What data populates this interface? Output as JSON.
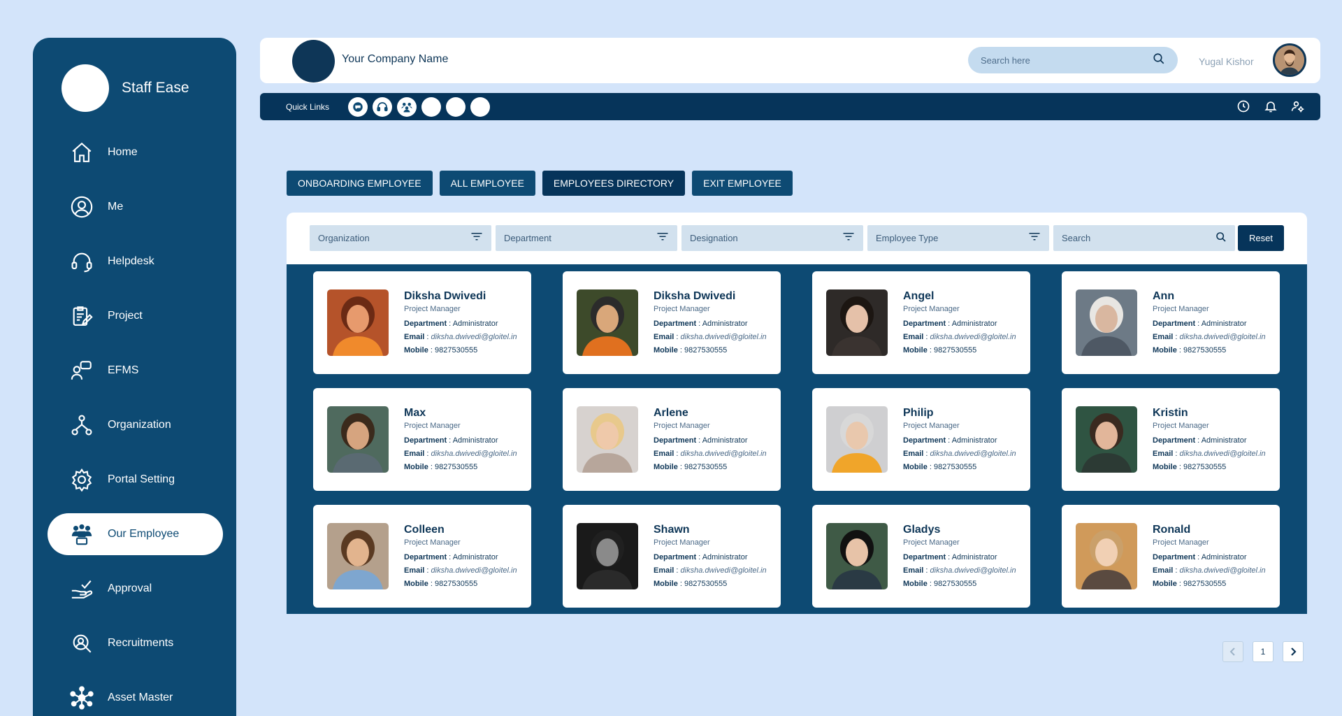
{
  "sidebar": {
    "brand": "Staff Ease",
    "items": [
      {
        "label": "Home",
        "icon": "home-icon"
      },
      {
        "label": "Me",
        "icon": "user-circle-icon"
      },
      {
        "label": "Helpdesk",
        "icon": "headset-icon"
      },
      {
        "label": "Project",
        "icon": "clipboard-edit-icon"
      },
      {
        "label": "EFMS",
        "icon": "chat-user-icon"
      },
      {
        "label": "Organization",
        "icon": "org-tree-icon"
      },
      {
        "label": "Portal Setting",
        "icon": "gear-icon"
      },
      {
        "label": "Our Employee",
        "icon": "team-icon",
        "active": true
      },
      {
        "label": "Approval",
        "icon": "hand-check-icon"
      },
      {
        "label": "Recruitments",
        "icon": "recruit-icon"
      },
      {
        "label": "Asset Master",
        "icon": "network-icon"
      }
    ]
  },
  "header": {
    "company_name": "Your Company Name",
    "search_placeholder": "Search here",
    "user_name": "Yugal Kishor"
  },
  "quickbar": {
    "label": "Quick Links"
  },
  "tabs": [
    {
      "label": "ONBOARDING EMPLOYEE"
    },
    {
      "label": "ALL EMPLOYEE"
    },
    {
      "label": "EMPLOYEES DIRECTORY",
      "active": true
    },
    {
      "label": "EXIT EMPLOYEE"
    }
  ],
  "filters": {
    "organization": "Organization",
    "department": "Department",
    "designation": "Designation",
    "employee_type": "Employee Type",
    "search_placeholder": "Search",
    "reset": "Reset"
  },
  "card_labels": {
    "department": "Department",
    "email": "Email",
    "mobile": "Mobile"
  },
  "employees": [
    {
      "name": "Diksha Dwivedi",
      "role": "Project Manager",
      "department": "Administrator",
      "email": "diksha.dwivedi@gloitel.in",
      "mobile": "9827530555"
    },
    {
      "name": "Diksha Dwivedi",
      "role": "Project Manager",
      "department": "Administrator",
      "email": "diksha.dwivedi@gloitel.in",
      "mobile": "9827530555"
    },
    {
      "name": "Angel",
      "role": "Project Manager",
      "department": "Administrator",
      "email": "diksha.dwivedi@gloitel.in",
      "mobile": "9827530555"
    },
    {
      "name": "Ann",
      "role": "Project Manager",
      "department": "Administrator",
      "email": "diksha.dwivedi@gloitel.in",
      "mobile": "9827530555"
    },
    {
      "name": "Max",
      "role": "Project Manager",
      "department": "Administrator",
      "email": "diksha.dwivedi@gloitel.in",
      "mobile": "9827530555"
    },
    {
      "name": "Arlene",
      "role": "Project Manager",
      "department": "Administrator",
      "email": "diksha.dwivedi@gloitel.in",
      "mobile": "9827530555"
    },
    {
      "name": "Philip",
      "role": "Project Manager",
      "department": "Administrator",
      "email": "diksha.dwivedi@gloitel.in",
      "mobile": "9827530555"
    },
    {
      "name": "Kristin",
      "role": "Project Manager",
      "department": "Administrator",
      "email": "diksha.dwivedi@gloitel.in",
      "mobile": "9827530555"
    },
    {
      "name": "Colleen",
      "role": "Project Manager",
      "department": "Administrator",
      "email": "diksha.dwivedi@gloitel.in",
      "mobile": "9827530555"
    },
    {
      "name": "Shawn",
      "role": "Project Manager",
      "department": "Administrator",
      "email": "diksha.dwivedi@gloitel.in",
      "mobile": "9827530555"
    },
    {
      "name": "Gladys",
      "role": "Project Manager",
      "department": "Administrator",
      "email": "diksha.dwivedi@gloitel.in",
      "mobile": "9827530555"
    },
    {
      "name": "Ronald",
      "role": "Project Manager",
      "department": "Administrator",
      "email": "diksha.dwivedi@gloitel.in",
      "mobile": "9827530555"
    }
  ],
  "pagination": {
    "current": "1"
  },
  "colors": {
    "background": "#d3e4fa",
    "primary": "#0d4a73",
    "dark": "#06345a",
    "input_bg": "#d2e1ee"
  }
}
